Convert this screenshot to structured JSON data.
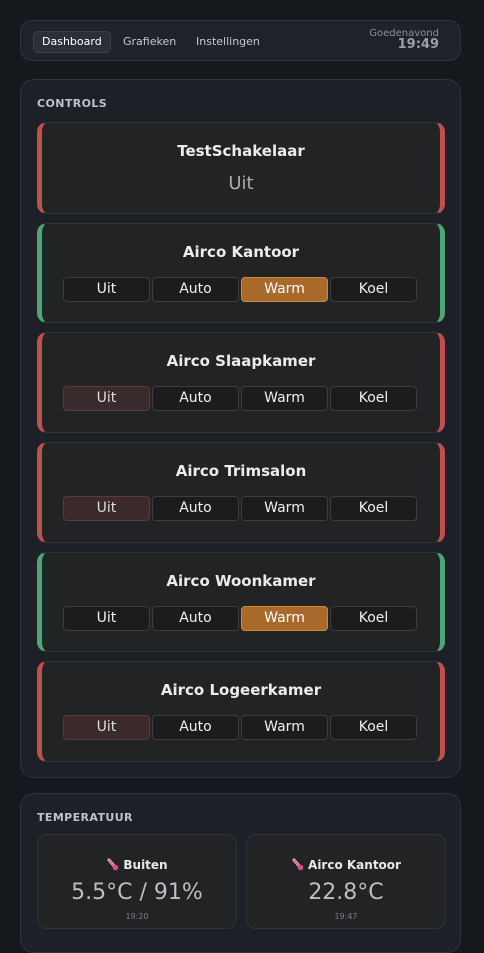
{
  "nav": {
    "tabs": [
      {
        "label": "Dashboard",
        "active": true
      },
      {
        "label": "Grafieken",
        "active": false
      },
      {
        "label": "Instellingen",
        "active": false
      }
    ],
    "greeting": "Goedenavond",
    "time": "19:49"
  },
  "controls": {
    "title": "CONTROLS",
    "switch": {
      "name": "TestSchakelaar",
      "state": "Uit",
      "on": false
    },
    "mode_labels": [
      "Uit",
      "Auto",
      "Warm",
      "Koel"
    ],
    "aircos": [
      {
        "name": "Airco Kantoor",
        "selected": "Warm",
        "on": true
      },
      {
        "name": "Airco Slaapkamer",
        "selected": "Uit",
        "on": false
      },
      {
        "name": "Airco Trimsalon",
        "selected": "Uit",
        "on": false
      },
      {
        "name": "Airco Woonkamer",
        "selected": "Warm",
        "on": true
      },
      {
        "name": "Airco Logeerkamer",
        "selected": "Uit",
        "on": false
      }
    ]
  },
  "temperature": {
    "title": "TEMPERATUUR",
    "cards": [
      {
        "label": "Buiten",
        "value": "5.5°C / 91%",
        "time": "19:20",
        "icon": "thermometer-icon"
      },
      {
        "label": "Airco Kantoor",
        "value": "22.8°C",
        "time": "19:47",
        "icon": "thermometer-icon"
      }
    ]
  },
  "colors": {
    "off_accent": "#c0504d",
    "on_accent": "#4fa577",
    "warm_selected": "#a8692a",
    "background": "#15181d"
  }
}
